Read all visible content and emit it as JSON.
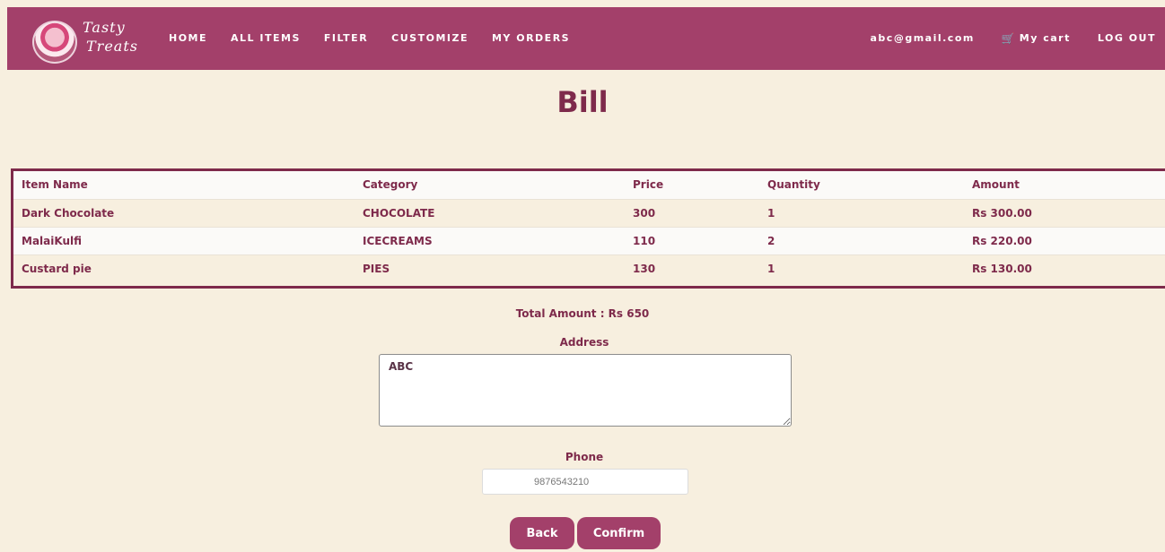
{
  "brand": {
    "line1": "Tasty",
    "line2": "Treats",
    "logo_icon": "cupcake-logo"
  },
  "nav": {
    "links": [
      "HOME",
      "ALL ITEMS",
      "FILTER",
      "CUSTOMIZE",
      "MY ORDERS"
    ],
    "user_email": "abc@gmail.com",
    "cart_label": "My cart",
    "cart_icon": "cart-icon",
    "logout_label": "LOG OUT"
  },
  "page": {
    "title": "Bill"
  },
  "bill_table": {
    "headers": [
      "Item Name",
      "Category",
      "Price",
      "Quantity",
      "Amount"
    ],
    "rows": [
      [
        "Dark Chocolate",
        "CHOCOLATE",
        "300",
        "1",
        "Rs 300.00"
      ],
      [
        "MalaiKulfi",
        "ICECREAMS",
        "110",
        "2",
        "Rs 220.00"
      ],
      [
        "Custard pie",
        "PIES",
        "130",
        "1",
        "Rs 130.00"
      ]
    ]
  },
  "summary": {
    "total_label": "Total Amount : Rs 650"
  },
  "form": {
    "address_label": "Address",
    "address_value": "ABC",
    "phone_label": "Phone",
    "phone_value": "9876543210"
  },
  "buttons": {
    "back": "Back",
    "confirm": "Confirm"
  },
  "colors": {
    "accent": "#a3406a",
    "text_dark": "#7e2a4b",
    "background": "#f7efdf"
  }
}
